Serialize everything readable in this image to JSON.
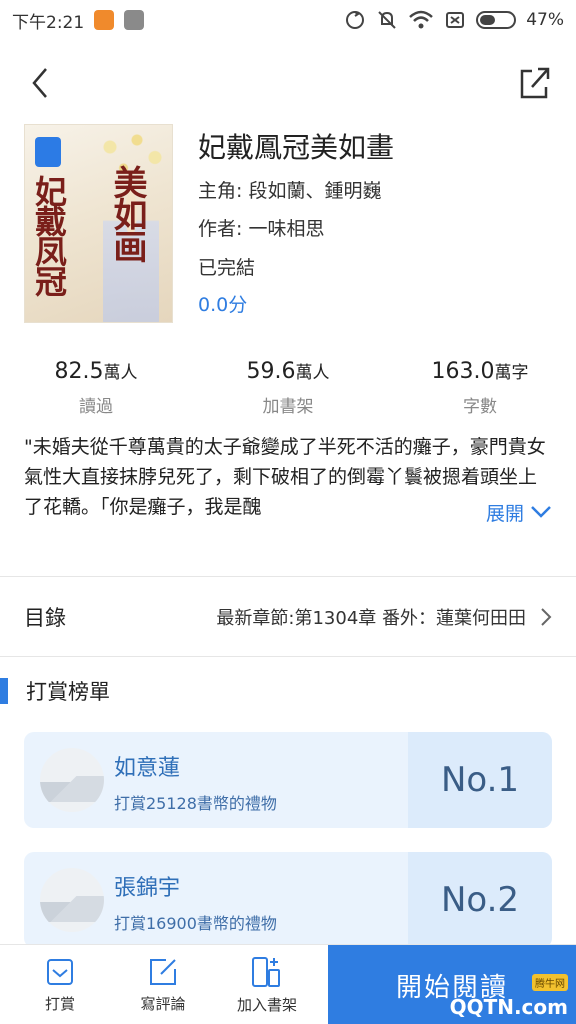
{
  "status_bar": {
    "time": "下午2:21",
    "battery": "47%",
    "battery_level": 0.47
  },
  "book": {
    "title": "妃戴鳳冠美如畫",
    "protagonists": "主角: 段如蘭、鍾明巍",
    "author": "作者: 一味相思",
    "status": "已完結",
    "score": "0.0分",
    "cover_art_text": [
      "美如画",
      "妃戴凤冠"
    ]
  },
  "stats": [
    {
      "value": "82.5",
      "unit": "萬人",
      "label": "讀過"
    },
    {
      "value": "59.6",
      "unit": "萬人",
      "label": "加書架"
    },
    {
      "value": "163.0",
      "unit": "萬字",
      "label": "字數"
    }
  ],
  "synopsis": {
    "text": "\"未婚夫從千尊萬貴的太子爺變成了半死不活的癱子，豪門貴女氣性大直接抹脖兒死了，剩下破相了的倒霉丫鬟被摁着頭坐上了花轎。「你是癱子，我是醜",
    "expand_label": "展開"
  },
  "catalog": {
    "label": "目錄",
    "latest": "最新章節:第1304章 番外：蓮葉何田田"
  },
  "reward": {
    "title": "打賞榜單",
    "ranks": [
      {
        "name": "如意蓮",
        "desc": "打賞25128書幣的禮物",
        "rank": "No.1"
      },
      {
        "name": "張錦宇",
        "desc": "打賞16900書幣的禮物",
        "rank": "No.2"
      }
    ]
  },
  "bottom_bar": {
    "tabs": [
      {
        "label": "打賞",
        "icon": "gift-card-icon"
      },
      {
        "label": "寫評論",
        "icon": "edit-icon"
      },
      {
        "label": "加入書架",
        "icon": "add-bookshelf-icon"
      }
    ],
    "read_button": "開始閱讀"
  },
  "watermark": {
    "text": "QQTN.com",
    "badge": "腾牛网"
  },
  "colors": {
    "accent": "#2f7de1",
    "rank_card": "#eaf3fd",
    "rank_text": "#3a5d86"
  }
}
